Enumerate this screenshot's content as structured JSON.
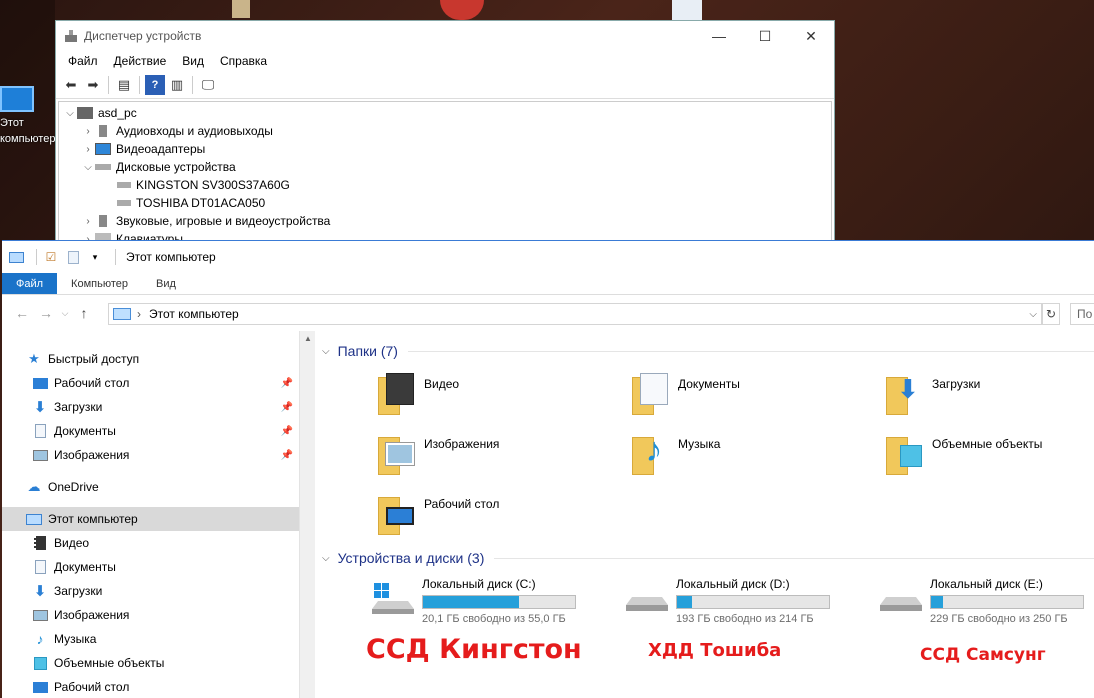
{
  "desktop": {
    "icon_label_line1": "Этот",
    "icon_label_line2": "компьютер"
  },
  "device_manager": {
    "title": "Диспетчер устройств",
    "window_buttons": {
      "minimize": "—",
      "maximize": "☐",
      "close": "✕"
    },
    "menu": [
      "Файл",
      "Действие",
      "Вид",
      "Справка"
    ],
    "tree": [
      {
        "label": "asd_pc",
        "level": 0,
        "expander": "expanded"
      },
      {
        "label": "Аудиовходы и аудиовыходы",
        "level": 1,
        "expander": "collapsed"
      },
      {
        "label": "Видеоадаптеры",
        "level": 1,
        "expander": "collapsed"
      },
      {
        "label": "Дисковые устройства",
        "level": 1,
        "expander": "expanded"
      },
      {
        "label": "KINGSTON SV300S37A60G",
        "level": 2,
        "expander": "none"
      },
      {
        "label": "TOSHIBA DT01ACA050",
        "level": 2,
        "expander": "none"
      },
      {
        "label": "Звуковые, игровые и видеоустройства",
        "level": 1,
        "expander": "collapsed"
      },
      {
        "label": "Клавиатуры",
        "level": 1,
        "expander": "collapsed"
      }
    ]
  },
  "explorer": {
    "title": "Этот компьютер",
    "ribbon_tabs": [
      "Файл",
      "Компьютер",
      "Вид"
    ],
    "address": {
      "crumb": "Этот компьютер"
    },
    "search_placeholder": "По",
    "nav": {
      "quick_access": "Быстрый доступ",
      "quick_items": [
        "Рабочий стол",
        "Загрузки",
        "Документы",
        "Изображения"
      ],
      "onedrive": "OneDrive",
      "this_pc": "Этот компьютер",
      "pc_items": [
        "Видео",
        "Документы",
        "Загрузки",
        "Изображения",
        "Музыка",
        "Объемные объекты",
        "Рабочий стол"
      ]
    },
    "folders_header": "Папки (7)",
    "folders": [
      "Видео",
      "Документы",
      "Загрузки",
      "Изображения",
      "Музыка",
      "Объемные объекты",
      "Рабочий стол"
    ],
    "devices_header": "Устройства и диски (3)",
    "drives": [
      {
        "name": "Локальный диск (C:)",
        "free": "20,1 ГБ свободно из 55,0 ГБ",
        "used_fraction": 0.63
      },
      {
        "name": "Локальный диск (D:)",
        "free": "193 ГБ свободно из 214 ГБ",
        "used_fraction": 0.1
      },
      {
        "name": "Локальный диск (E:)",
        "free": "229 ГБ свободно из 250 ГБ",
        "used_fraction": 0.08
      }
    ]
  },
  "annotations": [
    "ССД Кингстон",
    "ХДД Тошиба",
    "ССД Самсунг"
  ],
  "colors": {
    "accent": "#1a73c9",
    "bar_fill": "#26a0da",
    "annotation": "#e51c1c",
    "header_text": "#1e3287"
  }
}
